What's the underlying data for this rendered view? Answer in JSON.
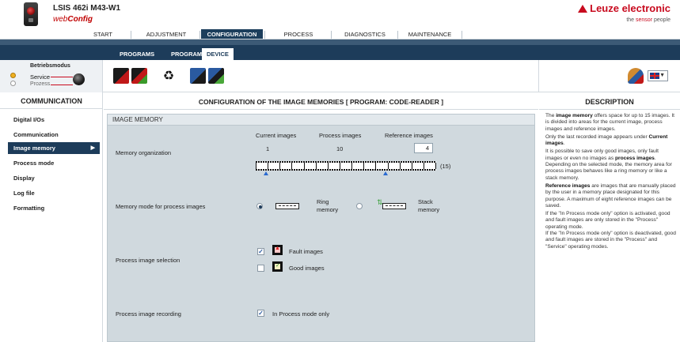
{
  "header": {
    "device_title": "LSIS 462i M43-W1",
    "app_name_web": "web",
    "app_name_config": "Config",
    "brand": "Leuze electronic",
    "tagline_pre": "the ",
    "tagline_red": "sensor",
    "tagline_post": " people"
  },
  "main_nav": {
    "tabs": [
      {
        "label": "START",
        "active": false
      },
      {
        "label": "ADJUSTMENT",
        "active": false
      },
      {
        "label": "CONFIGURATION",
        "active": true
      },
      {
        "label": "PROCESS",
        "active": false
      },
      {
        "label": "DIAGNOSTICS",
        "active": false
      },
      {
        "label": "MAINTENANCE",
        "active": false
      }
    ]
  },
  "sub_nav": {
    "tabs": [
      {
        "label": "PROGRAMS",
        "active": false
      },
      {
        "label": "PROGRAM",
        "active": false
      },
      {
        "label": "DEVICE",
        "active": true
      }
    ]
  },
  "mode": {
    "label": "Betriebsmodus",
    "service": "Service",
    "process": "Prozess"
  },
  "sidebar": {
    "heading": "COMMUNICATION",
    "items": [
      {
        "label": "Digital I/Os",
        "active": false
      },
      {
        "label": "Communication",
        "active": false
      },
      {
        "label": "Image memory",
        "active": true
      },
      {
        "label": "Process mode",
        "active": false
      },
      {
        "label": "Display",
        "active": false
      },
      {
        "label": "Log file",
        "active": false
      },
      {
        "label": "Formatting",
        "active": false
      }
    ]
  },
  "main": {
    "title": "CONFIGURATION OF THE IMAGE MEMORIES   [ PROGRAM: CODE-READER ]",
    "panel_title": "IMAGE MEMORY",
    "memory_org": {
      "label": "Memory organization",
      "col_current": "Current images",
      "col_process": "Process images",
      "col_reference": "Reference images",
      "current_value": "1",
      "process_value": "10",
      "reference_value": "4",
      "total_label": "(15)",
      "total_slots": 15
    },
    "memory_mode": {
      "label": "Memory mode for process images",
      "ring_label_1": "Ring",
      "ring_label_2": "memory",
      "stack_label_1": "Stack",
      "stack_label_2": "memory",
      "selected": "ring"
    },
    "selection": {
      "label": "Process image selection",
      "fault_label": "Fault images",
      "fault_checked": true,
      "good_label": "Good images",
      "good_checked": false
    },
    "recording": {
      "label": "Process image recording",
      "option_label": "In Process mode only",
      "checked": true
    }
  },
  "description": {
    "heading": "DESCRIPTION",
    "p1_pre": "The ",
    "p1_bold": "image memory",
    "p1_post": " offers space for up to 15 images. It is divided into areas for the current image, process images and reference images.",
    "p2_pre": "Only the last recorded image appears under ",
    "p2_bold": "Current images",
    "p2_post": ".",
    "p3_pre": "It is possible to save only good images, only fault images or even no images as ",
    "p3_bold": "process images",
    "p3_post": ".",
    "p3b": "Depending on the selected mode, the memory area for process images behaves like a ring memory or like a stack memory.",
    "p4_bold": "Reference images",
    "p4_post": " are images that are manually placed by the user in a memory place designated for this purpose. A maximum of eight reference images can be saved.",
    "p5": "If the \"In Process mode only\" option is activated, good and fault images are only stored in the \"Process\" operating mode.",
    "p6": "If the \"In Process mode only\" option is deactivated, good and fault images are stored in the \"Process\" and \"Service\" operating modes."
  },
  "colors": {
    "nav_dark": "#1d3c5a",
    "brand_red": "#c80a1e",
    "panel_bg": "#d0d9de"
  }
}
